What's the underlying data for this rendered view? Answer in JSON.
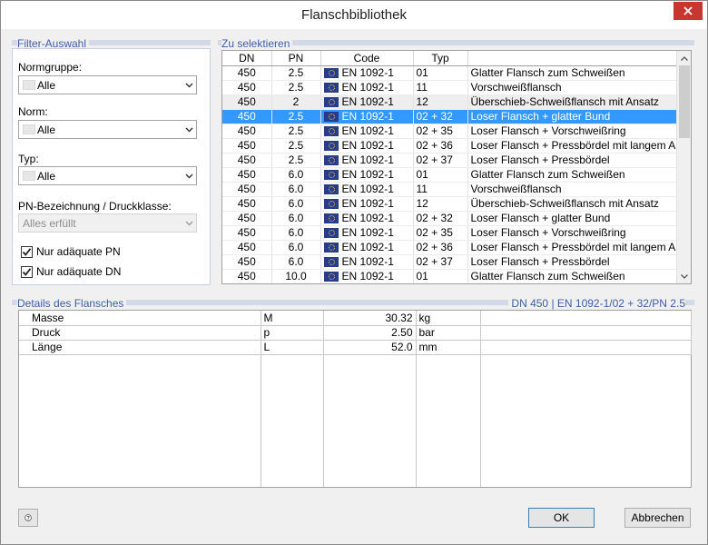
{
  "window": {
    "title": "Flanschbibliothek"
  },
  "filter": {
    "group_title": "Filter-Auswahl",
    "normgruppe_label": "Normgruppe:",
    "normgruppe_value": "Alle",
    "norm_label": "Norm:",
    "norm_value": "Alle",
    "typ_label": "Typ:",
    "typ_value": "Alle",
    "pn_label": "PN-Bezeichnung / Druckklasse:",
    "pn_value": "Alles erfüllt",
    "check_pn_label": "Nur adäquate PN",
    "check_pn_checked": true,
    "check_dn_label": "Nur adäquate DN",
    "check_dn_checked": true
  },
  "select": {
    "group_title": "Zu selektieren",
    "columns": [
      "DN",
      "PN",
      "Code",
      "Typ",
      ""
    ],
    "selected_index": 3,
    "shaded_index": 2,
    "rows": [
      [
        "450",
        "2.5",
        "EN 1092-1",
        "01",
        "Glatter Flansch zum Schweißen"
      ],
      [
        "450",
        "2.5",
        "EN 1092-1",
        "11",
        "Vorschweißflansch"
      ],
      [
        "450",
        "2",
        "EN 1092-1",
        "12",
        "Überschieb-Schweißflansch mit Ansatz"
      ],
      [
        "450",
        "2.5",
        "EN 1092-1",
        "02 + 32",
        "Loser Flansch + glatter Bund"
      ],
      [
        "450",
        "2.5",
        "EN 1092-1",
        "02 + 35",
        "Loser Flansch + Vorschweißring"
      ],
      [
        "450",
        "2.5",
        "EN 1092-1",
        "02 + 36",
        "Loser Flansch + Pressbördel mit langem Anzatz"
      ],
      [
        "450",
        "2.5",
        "EN 1092-1",
        "02 + 37",
        "Loser Flansch + Pressbördel"
      ],
      [
        "450",
        "6.0",
        "EN 1092-1",
        "01",
        "Glatter Flansch zum Schweißen"
      ],
      [
        "450",
        "6.0",
        "EN 1092-1",
        "11",
        "Vorschweißflansch"
      ],
      [
        "450",
        "6.0",
        "EN 1092-1",
        "12",
        "Überschieb-Schweißflansch mit Ansatz"
      ],
      [
        "450",
        "6.0",
        "EN 1092-1",
        "02 + 32",
        "Loser Flansch + glatter Bund"
      ],
      [
        "450",
        "6.0",
        "EN 1092-1",
        "02 + 35",
        "Loser Flansch + Vorschweißring"
      ],
      [
        "450",
        "6.0",
        "EN 1092-1",
        "02 + 36",
        "Loser Flansch + Pressbördel mit langem Anzatz"
      ],
      [
        "450",
        "6.0",
        "EN 1092-1",
        "02 + 37",
        "Loser Flansch + Pressbördel"
      ],
      [
        "450",
        "10.0",
        "EN 1092-1",
        "01",
        "Glatter Flansch zum Schweißen"
      ]
    ]
  },
  "details": {
    "group_title": "Details des Flansches",
    "summary": "DN 450 | EN 1092-1/02 + 32/PN 2.5",
    "rows": [
      [
        "Masse",
        "M",
        "30.32",
        "kg"
      ],
      [
        "Druck",
        "p",
        "2.50",
        "bar"
      ],
      [
        "Länge",
        "L",
        "52.0",
        "mm"
      ]
    ]
  },
  "buttons": {
    "ok": "OK",
    "cancel": "Abbrechen"
  },
  "icons": {
    "close": "close-icon",
    "help": "help-icon",
    "flag": "eu-flag-icon",
    "dropdown": "chevron-down-icon"
  },
  "colors": {
    "selection": "#3399ff",
    "group_title": "#3c5ea8",
    "close_button": "#c7372f"
  }
}
